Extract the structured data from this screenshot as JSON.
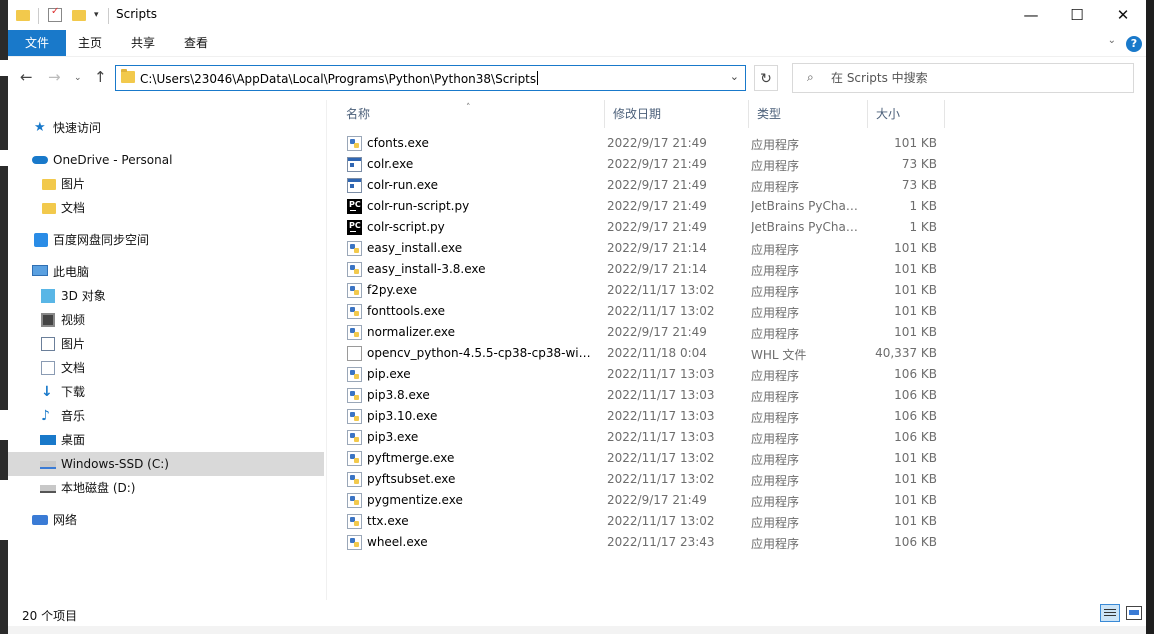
{
  "window": {
    "title": "Scripts",
    "controls": {
      "minimize": "—",
      "maximize": "☐",
      "close": "✕"
    }
  },
  "ribbon": {
    "tabs": [
      "文件",
      "主页",
      "共享",
      "查看"
    ],
    "help": "?"
  },
  "address": {
    "path": "C:\\Users\\23046\\AppData\\Local\\Programs\\Python\\Python38\\Scripts"
  },
  "search": {
    "placeholder": "在 Scripts 中搜索"
  },
  "navpane": {
    "items": [
      {
        "label": "快速访问",
        "icon": "star-icon"
      },
      {
        "label": "OneDrive - Personal",
        "icon": "cloud-icon"
      },
      {
        "label": "图片",
        "icon": "folder-icon"
      },
      {
        "label": "文档",
        "icon": "folder-icon"
      },
      {
        "label": "百度网盘同步空间",
        "icon": "baidu-netdisk-icon"
      },
      {
        "label": "此电脑",
        "icon": "computer-icon"
      },
      {
        "label": "3D 对象",
        "icon": "3d-objects-icon"
      },
      {
        "label": "视频",
        "icon": "video-icon"
      },
      {
        "label": "图片",
        "icon": "pictures-icon"
      },
      {
        "label": "文档",
        "icon": "documents-icon"
      },
      {
        "label": "下载",
        "icon": "download-icon"
      },
      {
        "label": "音乐",
        "icon": "music-icon"
      },
      {
        "label": "桌面",
        "icon": "desktop-icon"
      },
      {
        "label": "Windows-SSD (C:)",
        "icon": "drive-icon",
        "selected": true
      },
      {
        "label": "本地磁盘 (D:)",
        "icon": "drive-icon"
      },
      {
        "label": "网络",
        "icon": "network-icon"
      }
    ]
  },
  "columns": {
    "name": "名称",
    "date": "修改日期",
    "type": "类型",
    "size": "大小"
  },
  "files": [
    {
      "name": "cfonts.exe",
      "date": "2022/9/17 21:49",
      "type": "应用程序",
      "size": "101 KB",
      "icon": "python-exe-icon"
    },
    {
      "name": "colr.exe",
      "date": "2022/9/17 21:49",
      "type": "应用程序",
      "size": "73 KB",
      "icon": "window-exe-icon"
    },
    {
      "name": "colr-run.exe",
      "date": "2022/9/17 21:49",
      "type": "应用程序",
      "size": "73 KB",
      "icon": "window-exe-icon"
    },
    {
      "name": "colr-run-script.py",
      "date": "2022/9/17 21:49",
      "type": "JetBrains PyCharm...",
      "size": "1 KB",
      "icon": "pycharm-file-icon"
    },
    {
      "name": "colr-script.py",
      "date": "2022/9/17 21:49",
      "type": "JetBrains PyCharm...",
      "size": "1 KB",
      "icon": "pycharm-file-icon"
    },
    {
      "name": "easy_install.exe",
      "date": "2022/9/17 21:14",
      "type": "应用程序",
      "size": "101 KB",
      "icon": "python-exe-icon"
    },
    {
      "name": "easy_install-3.8.exe",
      "date": "2022/9/17 21:14",
      "type": "应用程序",
      "size": "101 KB",
      "icon": "python-exe-icon"
    },
    {
      "name": "f2py.exe",
      "date": "2022/11/17 13:02",
      "type": "应用程序",
      "size": "101 KB",
      "icon": "python-exe-icon"
    },
    {
      "name": "fonttools.exe",
      "date": "2022/11/17 13:02",
      "type": "应用程序",
      "size": "101 KB",
      "icon": "python-exe-icon"
    },
    {
      "name": "normalizer.exe",
      "date": "2022/9/17 21:49",
      "type": "应用程序",
      "size": "101 KB",
      "icon": "python-exe-icon"
    },
    {
      "name": "opencv_python-4.5.5-cp38-cp38-win_...",
      "date": "2022/11/18 0:04",
      "type": "WHL 文件",
      "size": "40,337 KB",
      "icon": "generic-file-icon"
    },
    {
      "name": "pip.exe",
      "date": "2022/11/17 13:03",
      "type": "应用程序",
      "size": "106 KB",
      "icon": "python-exe-icon"
    },
    {
      "name": "pip3.8.exe",
      "date": "2022/11/17 13:03",
      "type": "应用程序",
      "size": "106 KB",
      "icon": "python-exe-icon"
    },
    {
      "name": "pip3.10.exe",
      "date": "2022/11/17 13:03",
      "type": "应用程序",
      "size": "106 KB",
      "icon": "python-exe-icon"
    },
    {
      "name": "pip3.exe",
      "date": "2022/11/17 13:03",
      "type": "应用程序",
      "size": "106 KB",
      "icon": "python-exe-icon"
    },
    {
      "name": "pyftmerge.exe",
      "date": "2022/11/17 13:02",
      "type": "应用程序",
      "size": "101 KB",
      "icon": "python-exe-icon"
    },
    {
      "name": "pyftsubset.exe",
      "date": "2022/11/17 13:02",
      "type": "应用程序",
      "size": "101 KB",
      "icon": "python-exe-icon"
    },
    {
      "name": "pygmentize.exe",
      "date": "2022/9/17 21:49",
      "type": "应用程序",
      "size": "101 KB",
      "icon": "python-exe-icon"
    },
    {
      "name": "ttx.exe",
      "date": "2022/11/17 13:02",
      "type": "应用程序",
      "size": "101 KB",
      "icon": "python-exe-icon"
    },
    {
      "name": "wheel.exe",
      "date": "2022/11/17 23:43",
      "type": "应用程序",
      "size": "106 KB",
      "icon": "python-exe-icon"
    }
  ],
  "status": {
    "count": "20 个项目"
  },
  "colors": {
    "accent": "#1979ca",
    "selection": "#d9d9d9",
    "header_text": "#4c607a",
    "secondary_text": "#6d6d6d"
  }
}
